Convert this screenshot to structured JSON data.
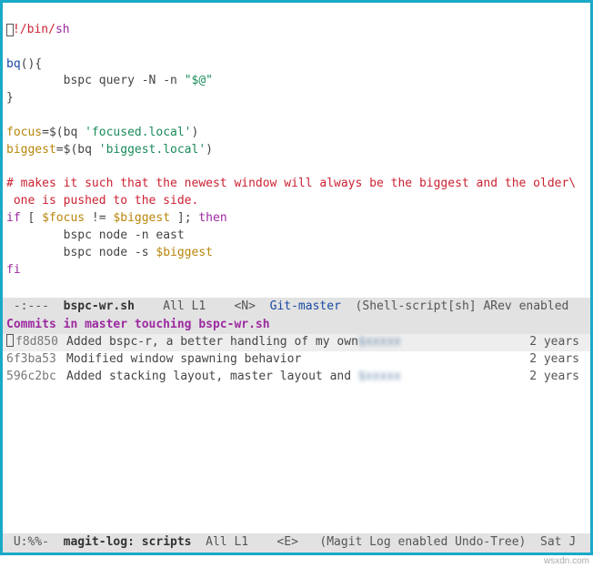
{
  "code": {
    "shebang_prefix": "!/bin/",
    "shebang_shell": "sh",
    "fn_name": "bq",
    "fn_open": "(){",
    "fn_body_cmd": "bspc query -N -n ",
    "fn_body_arg": "\"$@\"",
    "fn_close": "}",
    "focus_var": "focus",
    "focus_eq": "=$(",
    "bq_call": "bq ",
    "focus_arg": "'focused.local'",
    "focus_end": ")",
    "biggest_var": "biggest",
    "biggest_arg": "'biggest.local'",
    "comment1": "# makes it such that the newest window will always be the biggest and the older\\",
    "comment2": " one is pushed to the side.",
    "if_kw": "if",
    "if_cond_open": " [ ",
    "focus_ref": "$focus",
    "if_op": " != ",
    "biggest_ref": "$biggest",
    "if_cond_close": " ]; ",
    "then_kw": "then",
    "node_east": "bspc node -n east",
    "node_s": "bspc node -s ",
    "fi_kw": "fi"
  },
  "modeline1": {
    "left": " -:---  ",
    "buffer": "bspc-wr.sh",
    "mid1": "    All L1    <N>  ",
    "git": "Git-master",
    "mid2": "  (Shell-script[sh] ARev enabled"
  },
  "magit": {
    "header": "Commits in master touching bspc-wr.sh",
    "commits": [
      {
        "hash": "f8d850",
        "msg": "Added bspc-r, a better handling of my own",
        "tail": "$xxxxx",
        "age": "2 years"
      },
      {
        "hash": "6f3ba53",
        "msg": "Modified window spawning behavior",
        "tail": "",
        "age": "2 years"
      },
      {
        "hash": "596c2bc",
        "msg": "Added stacking layout, master layout and ",
        "tail": "$xxxxx",
        "age": "2 years"
      }
    ]
  },
  "modeline2": {
    "left": " U:%%-  ",
    "buffer": "magit-log: scripts",
    "mid": "  All L1    <E>   (Magit Log enabled Undo-Tree)  Sat J"
  },
  "watermark": "wsxdn.com"
}
